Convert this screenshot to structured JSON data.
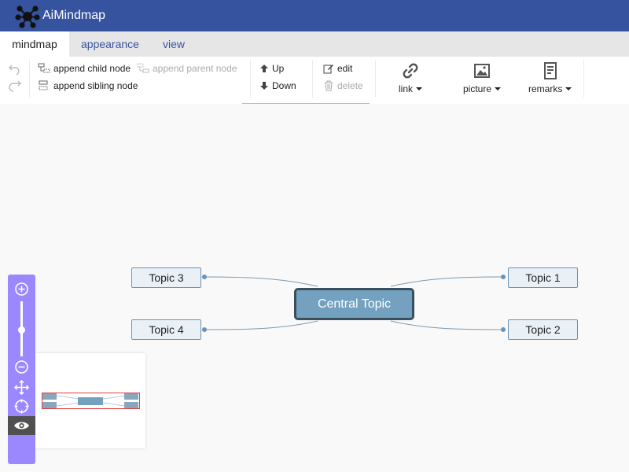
{
  "app": {
    "title": "AiMindmap"
  },
  "tabs": [
    {
      "label": "mindmap",
      "active": true
    },
    {
      "label": "appearance",
      "active": false
    },
    {
      "label": "view",
      "active": false
    }
  ],
  "toolbar": {
    "append_child": "append child node",
    "append_parent": "append parent node",
    "append_sibling": "append sibling node",
    "up": "Up",
    "down": "Down",
    "edit": "edit",
    "delete": "delete",
    "link": "link",
    "picture": "picture",
    "remarks": "remarks"
  },
  "mindmap": {
    "central": "Central Topic",
    "topics": [
      "Topic 1",
      "Topic 2",
      "Topic 3",
      "Topic 4"
    ]
  },
  "colors": {
    "titlebar": "#3653a0",
    "tab_text": "#3653a0",
    "central_fill": "#73a1bf",
    "central_border": "#3a4f5e",
    "node_fill": "#eaf1f6",
    "node_border": "#6b93b3",
    "zoombar": "#9b88ff",
    "minimap_viewport": "#e04040"
  }
}
